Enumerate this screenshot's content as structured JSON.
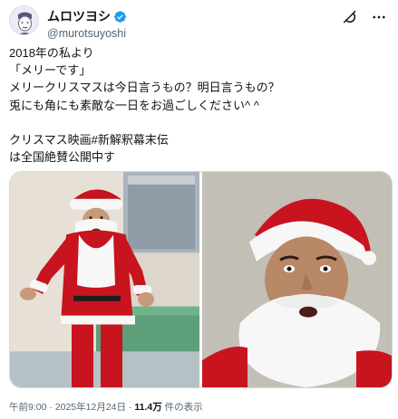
{
  "user": {
    "display_name": "ムロツヨシ",
    "handle": "@murotsuyoshi",
    "verified_color": "#1d9bf0"
  },
  "header_actions": {
    "grok_icon": "grok-icon",
    "more_icon": "more-icon"
  },
  "tweet": {
    "lines": [
      "2018年の私より",
      "「メリーです」",
      "メリークリスマスは今日言うもの？明日言うもの？",
      "兎にも角にも素敵な一日をお過ごしください^ ^",
      "",
      "クリスマス映画#新解釈幕末伝",
      "は全国絶賛公開中す"
    ]
  },
  "media": {
    "photos": [
      "santa-full-body-photo",
      "santa-selfie-photo"
    ]
  },
  "meta": {
    "time": "午前9:00",
    "sep1": " · ",
    "date": "2025年12月24日",
    "sep2": " · ",
    "views": "11.4万",
    "views_label": " 件の表示"
  },
  "colors": {
    "text": "#0f1419",
    "secondary": "#536471",
    "santa_red": "#c8141e",
    "beard_white": "#f7f7f7"
  }
}
